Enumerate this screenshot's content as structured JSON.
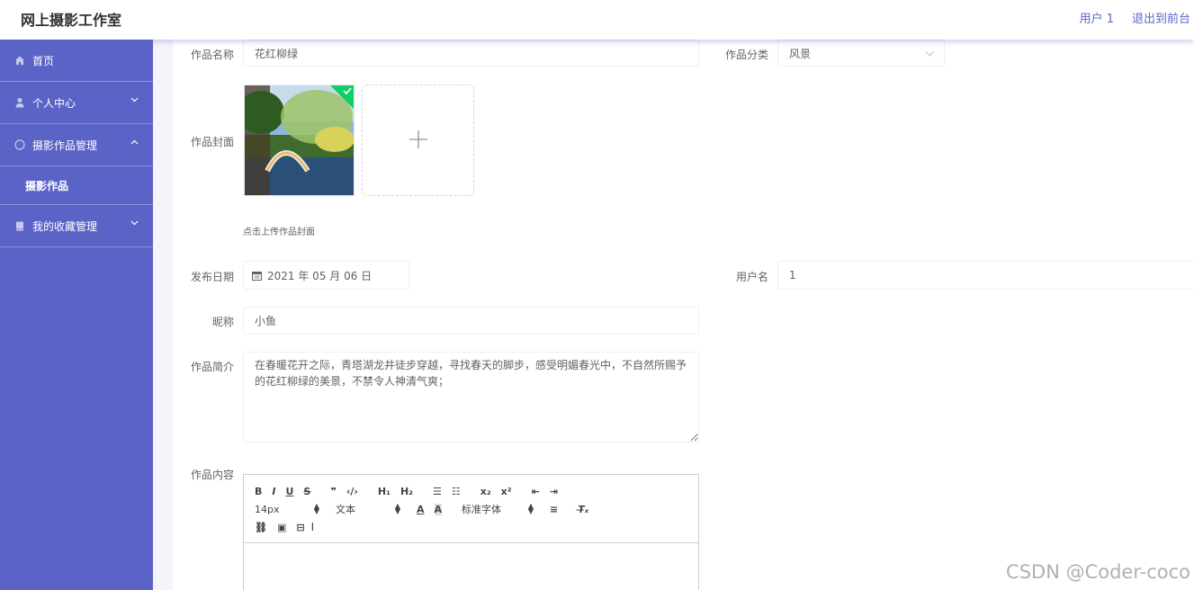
{
  "app": {
    "title": "网上摄影工作室"
  },
  "header": {
    "user": "用户 1",
    "logout": "退出到前台"
  },
  "sidebar": {
    "home": "首页",
    "personal": "个人中心",
    "works_mgmt": "摄影作品管理",
    "works": "摄影作品",
    "favorites": "我的收藏管理"
  },
  "form": {
    "name_label": "作品名称",
    "name_value": "花红柳绿",
    "category_label": "作品分类",
    "category_value": "风景",
    "cover_label": "作品封面",
    "cover_hint": "点击上传作品封面",
    "date_label": "发布日期",
    "date_value": "2021 年 05 月 06 日",
    "username_label": "用户名",
    "username_value": "1",
    "nickname_label": "昵称",
    "nickname_value": "小鱼",
    "intro_label": "作品简介",
    "intro_value": "在春暖花开之际，青塔湖龙井徒步穿越，寻找春天的脚步，感受明媚春光中，不自然所赐予的花红柳绿的美景，不禁令人神清气爽；",
    "content_label": "作品内容"
  },
  "editor": {
    "size": "14px",
    "header": "文本",
    "font": "标准字体"
  },
  "watermark": "CSDN @Coder-coco",
  "colors": {
    "sidebar": "#5b63c6",
    "accent": "#5a67c8"
  }
}
